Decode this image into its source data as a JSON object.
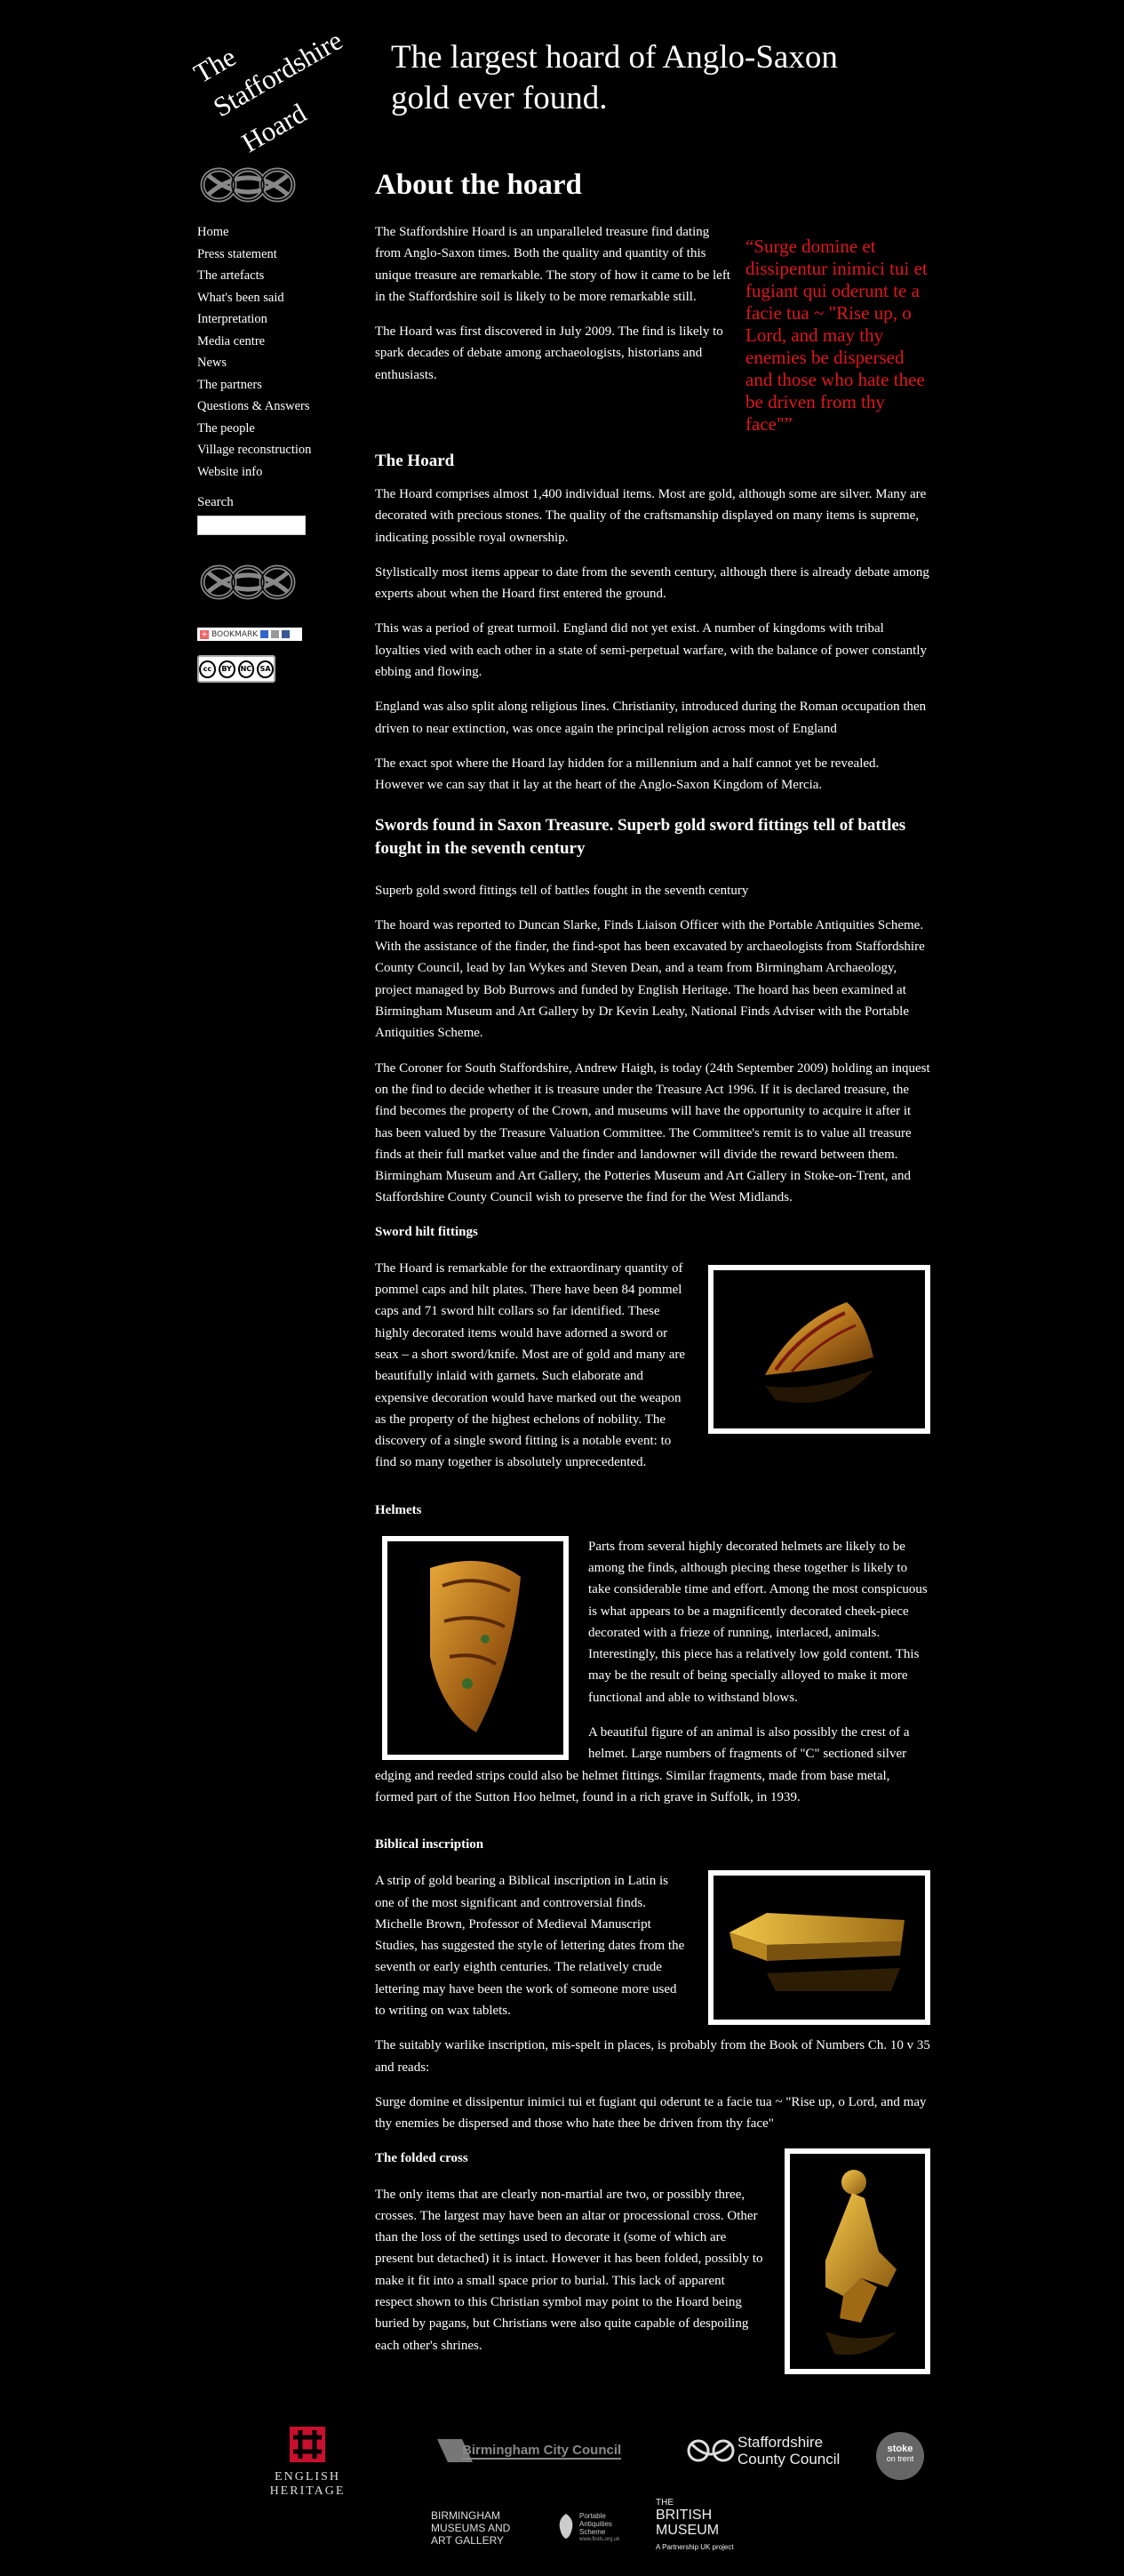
{
  "header": {
    "logo_line1": "The",
    "logo_line2": "Staffordshire",
    "logo_line3": "Hoard",
    "tagline_line1": "The largest hoard of Anglo-Saxon",
    "tagline_line2": "gold ever found."
  },
  "sidebar": {
    "knot_icon": "celtic-knot-icon",
    "nav": [
      "Home",
      "Press statement",
      "The artefacts",
      "What's been said",
      "Interpretation",
      "Media centre",
      "News",
      "The partners",
      "Questions & Answers",
      "The people",
      "Village reconstruction",
      "Website info"
    ],
    "search_label": "Search",
    "search_value": "",
    "bookmark_label": "BOOKMARK",
    "cc_labels": [
      "cc",
      "BY",
      "NC",
      "SA"
    ]
  },
  "main": {
    "title": "About the hoard",
    "quote": "“Surge domine et dissipentur inimici tui et fugiant qui oderunt te a facie tua ~ \"Rise up, o Lord, and may thy enemies be dispersed and those who hate thee be driven from thy face\"”",
    "intro": [
      "The Staffordshire Hoard is an unparalleled treasure find dating from Anglo-Saxon times. Both the quality and quantity of this unique treasure are remarkable. The story of how it came to be left in the Staffordshire soil is likely to be more remarkable still.",
      "The Hoard was first discovered in July 2009. The find is likely to spark decades of debate among archaeologists, historians and enthusiasts."
    ],
    "hoard_heading": "The Hoard",
    "hoard_paras": [
      "The Hoard comprises almost 1,400 individual items. Most are gold, although some are silver. Many are decorated with precious stones. The quality of the craftsmanship displayed on many items is supreme, indicating possible royal ownership.",
      "Stylistically most items appear to date from the seventh century, although there is already debate among experts about when the Hoard first entered the ground.",
      "This was a period of great turmoil. England did not yet exist. A number of kingdoms with tribal loyalties vied with each other in a state of semi-perpetual warfare, with the balance of power constantly ebbing and flowing.",
      "England was also split along religious lines. Christianity, introduced during the Roman occupation then driven to near extinction, was once again the principal religion across most of England",
      "The exact spot where the Hoard lay hidden for a millennium and a half cannot yet be revealed. However we can say that it lay at the heart of the Anglo-Saxon Kingdom of Mercia."
    ],
    "swords_heading": "Swords found in Saxon Treasure. Superb gold sword fittings tell of battles fought in the seventh century",
    "swords_paras": [
      "Superb gold sword fittings tell of battles fought in the seventh century",
      "The hoard was reported to Duncan Slarke, Finds Liaison Officer with the Portable Antiquities Scheme. With the assistance of the finder, the find-spot has been excavated by archaeologists from Staffordshire County Council, lead by Ian Wykes and Steven Dean, and a team from Birmingham Archaeology, project managed by Bob Burrows and funded by English Heritage. The hoard has been examined at Birmingham Museum and Art Gallery by Dr Kevin Leahy, National Finds Adviser with the Portable Antiquities Scheme.",
      "The Coroner for South Staffordshire, Andrew Haigh, is today (24th September 2009) holding an inquest on the find to decide whether it is treasure under the Treasure Act 1996. If it is declared treasure, the find becomes the property of the Crown, and museums will have the opportunity to acquire it after it has been valued by the Treasure Valuation Committee. The Committee's remit is to value all treasure finds at their full market value and the finder and landowner will divide the reward between them. Birmingham Museum and Art Gallery, the Potteries Museum and Art Gallery in Stoke-on-Trent, and Staffordshire County Council wish to preserve the find for the West Midlands."
    ],
    "hilt_heading": "Sword hilt fittings",
    "hilt_para": "The Hoard is remarkable for the extraordinary quantity of pommel caps and hilt plates. There have been 84 pommel caps and 71 sword hilt collars so far identified. These highly decorated items would have adorned a sword or seax – a short sword/knife. Most are of gold and many are beautifully inlaid with garnets. Such elaborate and expensive decoration would have marked out the weapon as the property of the highest echelons of nobility. The discovery of a single sword fitting is a notable event: to find so many together is absolutely unprecedented.",
    "helmets_heading": "Helmets",
    "helmets_paras": [
      "Parts from several highly decorated helmets are likely to be among the finds, although piecing these together is likely to take considerable time and effort. Among the most conspicuous is what appears to be a magnificently decorated cheek-piece decorated with a frieze of running, interlaced, animals. Interestingly, this piece has a relatively low gold content. This may be the result of being specially alloyed to make it more functional and able to withstand blows.",
      "A beautiful figure of an animal is also possibly the crest of a helmet. Large numbers of fragments of \"C\" sectioned silver edging and reeded strips could also be helmet fittings. Similar fragments, made from base metal, formed part of the Sutton Hoo helmet, found in a rich grave in Suffolk, in 1939."
    ],
    "biblical_heading": "Biblical inscription",
    "biblical_paras": [
      "A strip of gold bearing a Biblical inscription in Latin is one of the most significant and controversial finds. Michelle Brown, Professor of Medieval Manuscript Studies, has suggested the style of lettering dates from the seventh or early eighth centuries. The relatively crude lettering may have been the work of someone more used to writing on wax tablets.",
      "The suitably warlike inscription, mis-spelt in places, is probably from the Book of Numbers Ch. 10 v 35 and reads:",
      "Surge domine et dissipentur inimici tui et fugiant qui oderunt te a facie tua ~ \"Rise up, o Lord, and may thy enemies be dispersed and those who hate thee be driven from thy face\""
    ],
    "cross_heading": "The folded cross",
    "cross_para": "The only items that are clearly non-martial are two, or possibly three, crosses. The largest may have been an altar or processional cross. Other than the loss of the settings used to decorate it (some of which are present but detached) it is intact. However it has been folded, possibly to make it fit into a small space prior to burial. This lack of apparent respect shown to this Christian symbol may point to the Hoard being buried by pagans, but Christians were also quite capable of despoiling each other's shrines."
  },
  "footer": {
    "english_heritage": "ENGLISH HERITAGE",
    "birmingham_council": "Birmingham City Council",
    "staffs_line1": "Staffordshire",
    "staffs_line2": "County Council",
    "stoke_line1": "stoke",
    "stoke_line2": "on trent",
    "bmag_line1": "BIRMINGHAM",
    "bmag_line2": "MUSEUMS AND",
    "bmag_line3": "ART GALLERY",
    "pas_line1": "Portable",
    "pas_line2": "Antiquities",
    "pas_line3": "Scheme",
    "pas_url": "www.finds.org.uk",
    "bm_line1": "THE",
    "bm_line2": "BRITISH",
    "bm_line3": "MUSEUM",
    "bm_sub": "A Partnership UK project"
  },
  "colors": {
    "background": "#000000",
    "quote": "#e0161e",
    "text": "#ffffff"
  }
}
